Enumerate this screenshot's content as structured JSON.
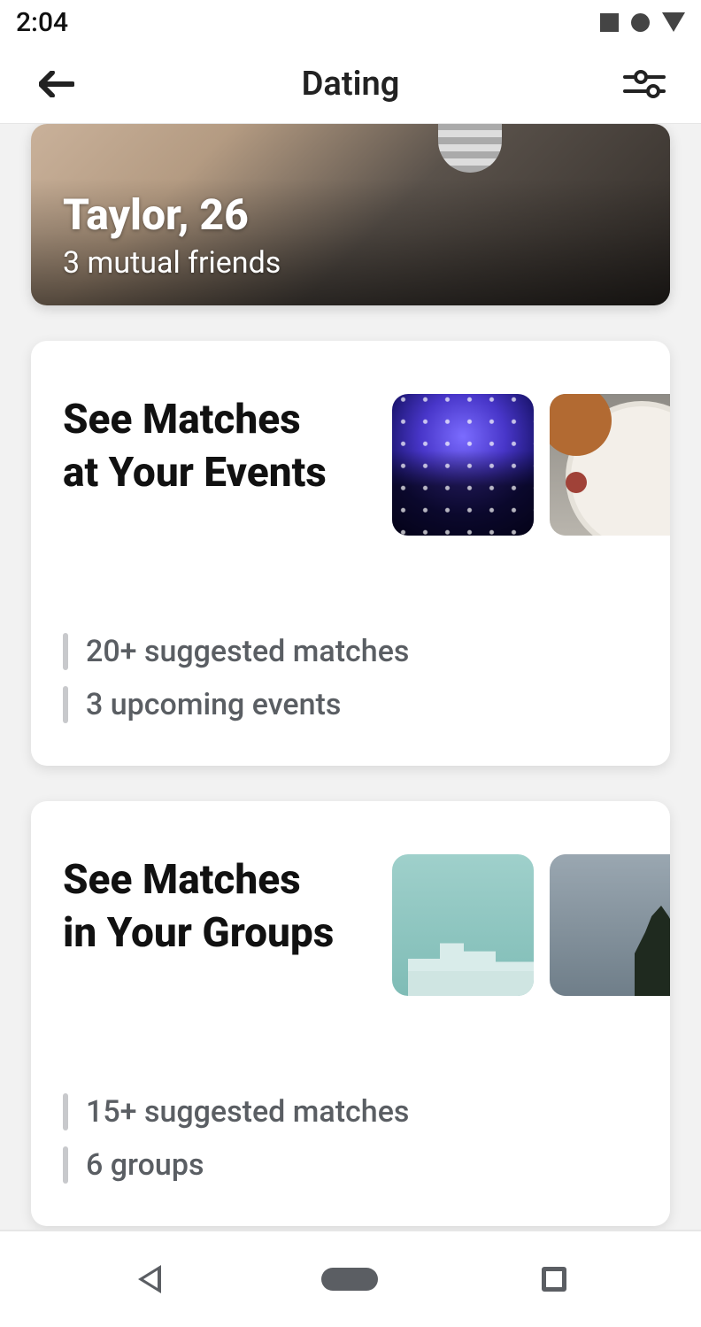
{
  "status": {
    "time": "2:04"
  },
  "header": {
    "title": "Dating"
  },
  "profile": {
    "name_age": "Taylor, 26",
    "subtitle": "3 mutual friends"
  },
  "cards": {
    "events": {
      "title_line1": "See Matches",
      "title_line2": "at Your Events",
      "stat1": "20+ suggested matches",
      "stat2": "3 upcoming events"
    },
    "groups": {
      "title_line1": "See Matches",
      "title_line2": "in Your Groups",
      "stat1": "15+ suggested matches",
      "stat2": "6 groups"
    }
  }
}
